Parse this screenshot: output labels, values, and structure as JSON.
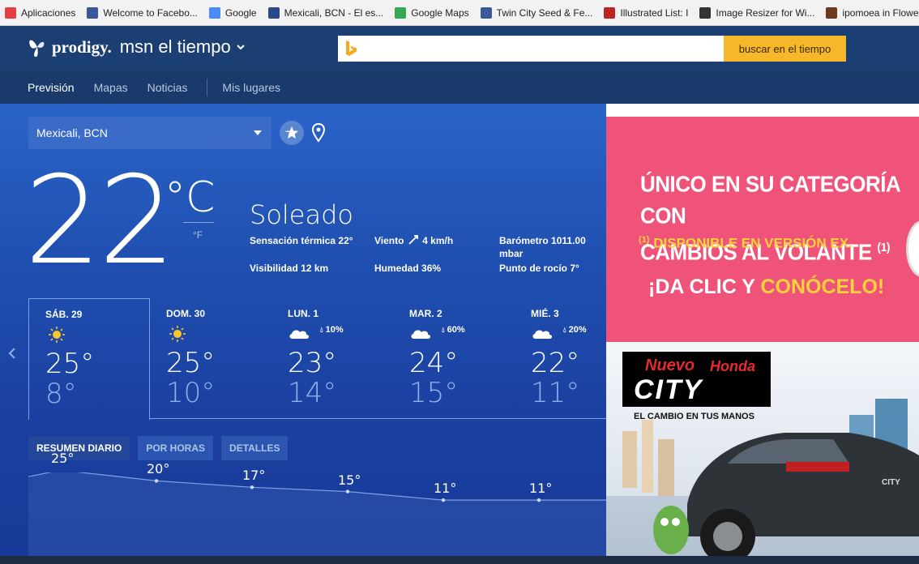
{
  "bookmarks": [
    {
      "label": "Aplicaciones",
      "icon": "apps-grid-icon",
      "color": "#e04040"
    },
    {
      "label": "Welcome to Facebo...",
      "icon": "facebook-icon",
      "color": "#3b5998"
    },
    {
      "label": "Google",
      "icon": "google-icon",
      "color": "#4a8af4"
    },
    {
      "label": "Mexicali, BCN - El es...",
      "icon": "weather-site-icon",
      "color": "#2a4a8a"
    },
    {
      "label": "Google Maps",
      "icon": "maps-icon",
      "color": "#34a853"
    },
    {
      "label": "Twin City Seed & Fe...",
      "icon": "facebook-icon",
      "color": "#3b5998"
    },
    {
      "label": "Illustrated List: I",
      "icon": "list-icon",
      "color": "#c02020"
    },
    {
      "label": "Image Resizer for Wi...",
      "icon": "resizer-icon",
      "color": "#333333"
    },
    {
      "label": "ipomoea in Flowers,...",
      "icon": "flowers-icon",
      "color": "#6a3a1a"
    }
  ],
  "header": {
    "brand": "prodigy.",
    "product": "msn el tiempo",
    "search_placeholder": "",
    "search_button": "buscar en el tiempo"
  },
  "nav": {
    "items": [
      "Previsión",
      "Mapas",
      "Noticias"
    ],
    "extra": "Mis lugares"
  },
  "location": "Mexicali, BCN",
  "current": {
    "temp": "22",
    "unit_c": "°C",
    "unit_f": "°F",
    "condition": "Soleado",
    "details": [
      {
        "key": "Sensación térmica",
        "value": "22°"
      },
      {
        "key": "Viento",
        "value": "4 km/h"
      },
      {
        "key": "Barómetro",
        "value": "1011.00"
      },
      {
        "key": "",
        "value": "mbar"
      },
      {
        "key": "Visibilidad",
        "value": "12 km"
      },
      {
        "key": "Humedad",
        "value": "36%"
      },
      {
        "key": "Punto de rocío",
        "value": "7°"
      }
    ]
  },
  "forecast": [
    {
      "label": "SÁB. 29",
      "icon": "sun",
      "pct": "",
      "hi": "25°",
      "lo": "8°"
    },
    {
      "label": "DOM. 30",
      "icon": "sun",
      "pct": "",
      "hi": "25°",
      "lo": "10°"
    },
    {
      "label": "LUN. 1",
      "icon": "cloud",
      "pct": "10%",
      "hi": "23°",
      "lo": "14°"
    },
    {
      "label": "MAR. 2",
      "icon": "cloud",
      "pct": "60%",
      "hi": "24°",
      "lo": "15°"
    },
    {
      "label": "MIÉ. 3",
      "icon": "cloud",
      "pct": "20%",
      "hi": "22°",
      "lo": "11°"
    }
  ],
  "tabs": [
    "RESUMEN DIARIO",
    "POR HORAS",
    "DETALLES"
  ],
  "graph": {
    "values": [
      25,
      20,
      17,
      15,
      11,
      11
    ],
    "labels": [
      "25°",
      "20°",
      "17°",
      "15°",
      "11°",
      "11°"
    ]
  },
  "ad": {
    "headline_1": "ÚNICO EN SU CATEGORÍA CON",
    "headline_2": "CAMBIOS AL VOLANTE",
    "headline_sup": "(1)",
    "sub_sup": "(1)",
    "sub": "DISPONIBLE EN VERSIÓN EX.",
    "cta_1": "¡DA CLIC Y",
    "cta_2": "CONÓCELO!",
    "logo_nuevo": "Nuevo",
    "logo_honda": "Honda",
    "logo_city": "CITY",
    "tagline": "EL CAMBIO EN TUS MANOS",
    "plate": "CITY"
  }
}
